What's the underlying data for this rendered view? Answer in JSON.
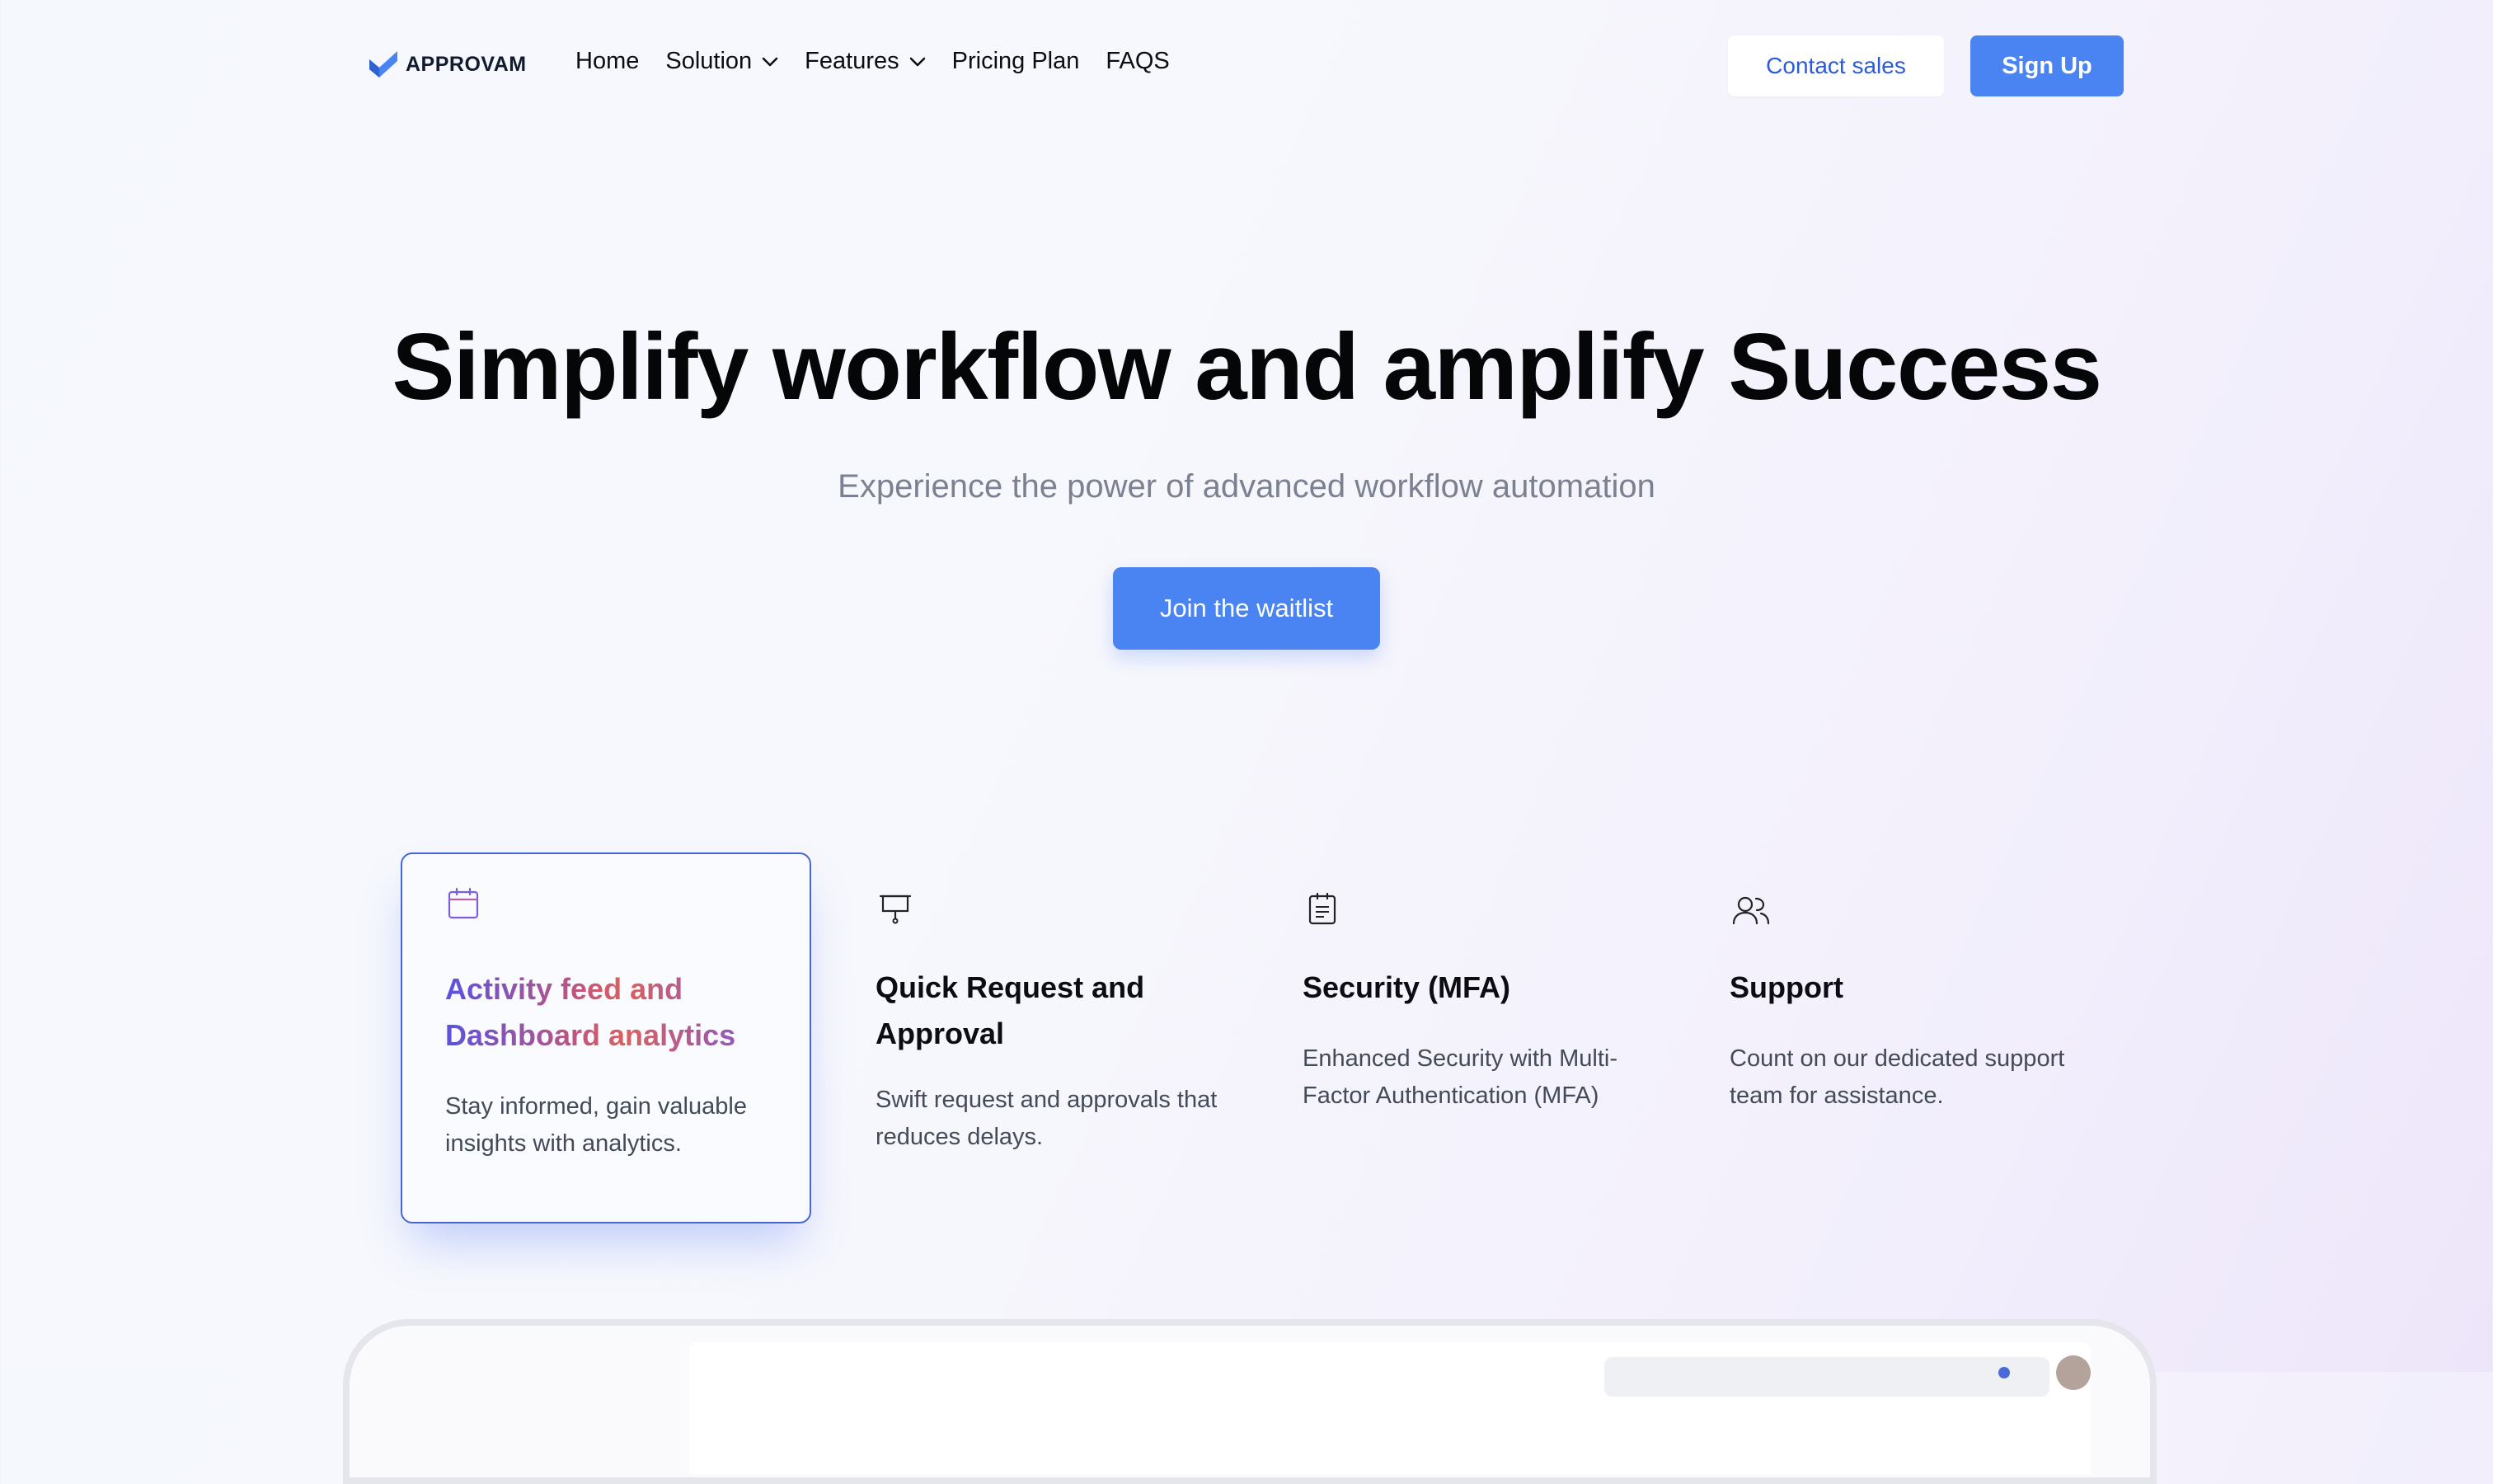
{
  "brand": {
    "name": "APPROVAM",
    "color": "#4a84f2"
  },
  "nav": {
    "items": [
      {
        "label": "Home",
        "has_dropdown": false
      },
      {
        "label": "Solution",
        "has_dropdown": true
      },
      {
        "label": "Features",
        "has_dropdown": true
      },
      {
        "label": "Pricing Plan",
        "has_dropdown": false
      },
      {
        "label": "FAQS",
        "has_dropdown": false
      }
    ],
    "contact_sales": "Contact sales",
    "sign_up": "Sign Up"
  },
  "hero": {
    "title": "Simplify workflow and amplify Success",
    "subtitle": "Experience the power of advanced workflow automation",
    "cta": "Join the waitlist"
  },
  "features": [
    {
      "icon": "calendar-icon",
      "title": "Activity feed and Dashboard analytics",
      "description": "Stay informed, gain valuable insights with analytics.",
      "active": true
    },
    {
      "icon": "presentation-board-icon",
      "title": "Quick Request and Approval",
      "description": "Swift request and approvals that reduces delays.",
      "active": false
    },
    {
      "icon": "clipboard-icon",
      "title": "Security (MFA)",
      "description": "Enhanced Security with Multi-Factor Authentication (MFA)",
      "active": false
    },
    {
      "icon": "users-icon",
      "title": "Support",
      "description": "Count on our dedicated support team for assistance.",
      "active": false
    }
  ],
  "colors": {
    "accent": "#4a84f2",
    "active_border": "#4466d8",
    "gradient_start": "#5a52df",
    "gradient_mid": "#d9615f",
    "gradient_end": "#7a56d8"
  }
}
